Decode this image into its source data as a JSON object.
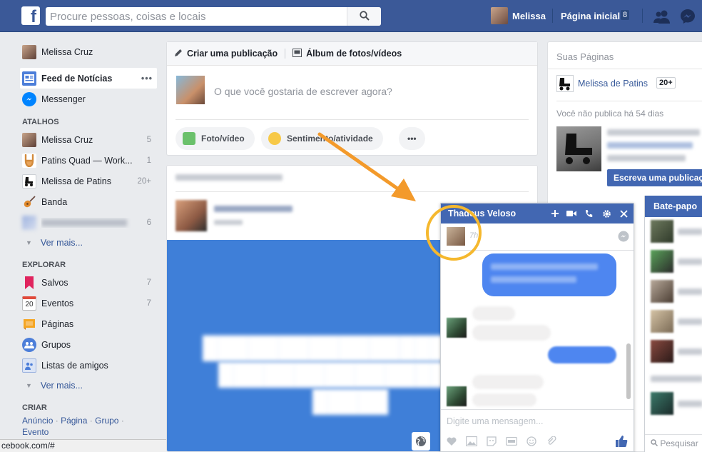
{
  "topbar": {
    "search_placeholder": "Procure pessoas, coisas e locais",
    "user_name": "Melissa",
    "home_label": "Página inicial",
    "home_badge": "8"
  },
  "leftnav": {
    "profile_name": "Melissa Cruz",
    "main": [
      {
        "label": "Feed de Notícias",
        "more": "•••"
      },
      {
        "label": "Messenger"
      }
    ],
    "shortcuts_title": "ATALHOS",
    "shortcuts": [
      {
        "label": "Melissa Cruz",
        "count": "5"
      },
      {
        "label": "Patins Quad — Work...",
        "count": "1"
      },
      {
        "label": "Melissa de Patins",
        "count": "20+"
      },
      {
        "label": "Banda",
        "count": ""
      },
      {
        "label": "",
        "count": "6"
      }
    ],
    "see_more_1": "Ver mais...",
    "explore_title": "EXPLORAR",
    "explore": [
      {
        "label": "Salvos",
        "count": "7"
      },
      {
        "label": "Eventos",
        "count": "7",
        "icon_text": "20"
      },
      {
        "label": "Páginas",
        "count": ""
      },
      {
        "label": "Grupos",
        "count": ""
      },
      {
        "label": "Listas de amigos",
        "count": ""
      }
    ],
    "see_more_2": "Ver mais...",
    "create_title": "CRIAR",
    "create_links": [
      "Anúncio",
      "Página",
      "Grupo",
      "Evento"
    ]
  },
  "composer": {
    "tab_create": "Criar uma publicação",
    "tab_album": "Álbum de fotos/vídeos",
    "prompt": "O que você gostaria de escrever agora?",
    "btn_photo": "Foto/vídeo",
    "btn_feeling": "Sentimento/atividade",
    "btn_more": "•••"
  },
  "rightcol": {
    "title": "Suas Páginas",
    "page_name": "Melissa de Patins",
    "page_badge": "20+",
    "note": "Você não publica há 54 dias",
    "write_btn": "Escreva uma publicação"
  },
  "chatlist": {
    "title": "Bate-papo",
    "search": "Pesquisar"
  },
  "chat": {
    "name": "Thadeus Veloso",
    "time": "7h",
    "input_placeholder": "Digite uma mensagem..."
  },
  "statusbar": {
    "url": "cebook.com/#"
  },
  "colors": {
    "brand": "#3b5998",
    "chat_header": "#4267b2",
    "annotation_arrow": "#f39a2b",
    "annotation_circle": "#f5b82e"
  }
}
